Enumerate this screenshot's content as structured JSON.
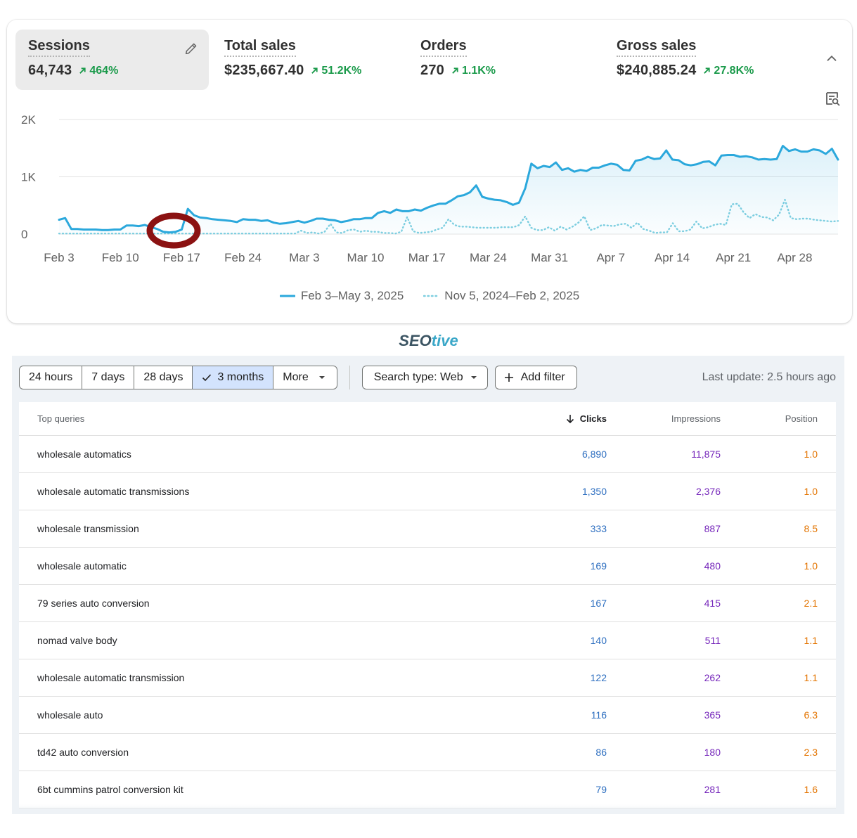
{
  "metrics": [
    {
      "label": "Sessions",
      "value": "64,743",
      "delta": "464%",
      "active": true
    },
    {
      "label": "Total sales",
      "value": "$235,667.40",
      "delta": "51.2K%"
    },
    {
      "label": "Orders",
      "value": "270",
      "delta": "1.1K%"
    },
    {
      "label": "Gross sales",
      "value": "$240,885.24",
      "delta": "27.8K%"
    }
  ],
  "icons": {
    "edit": "pencil-icon",
    "collapse": "chevron-up-icon",
    "zoom": "chart-search-icon",
    "delta": "arrow-up-right-icon",
    "sort": "arrow-down-icon",
    "check": "check-icon",
    "dropdown": "caret-down-icon",
    "add": "plus-icon"
  },
  "chart_data": {
    "type": "line",
    "x_tick_labels": [
      "Feb 3",
      "Feb 10",
      "Feb 17",
      "Feb 24",
      "Mar 3",
      "Mar 10",
      "Mar 17",
      "Mar 24",
      "Mar 31",
      "Apr 7",
      "Apr 14",
      "Apr 21",
      "Apr 28"
    ],
    "y_tick_labels": [
      "2K",
      "1K",
      "0"
    ],
    "ylim": [
      0,
      2000
    ],
    "x_range": [
      "Feb 3",
      "May 3"
    ],
    "grid": true,
    "legend_position": "bottom-center",
    "annotation": "red circle around Feb 14-Feb 17 dip",
    "series": [
      {
        "name": "Feb 3–May 3, 2025",
        "style": "solid",
        "color": "#2ba8dc",
        "values": [
          250,
          280,
          90,
          90,
          80,
          80,
          80,
          70,
          70,
          80,
          80,
          150,
          150,
          140,
          160,
          120,
          90,
          40,
          30,
          40,
          80,
          440,
          330,
          290,
          280,
          260,
          250,
          240,
          230,
          210,
          260,
          250,
          250,
          230,
          240,
          200,
          180,
          190,
          210,
          230,
          200,
          230,
          270,
          270,
          250,
          240,
          210,
          230,
          260,
          260,
          280,
          280,
          370,
          400,
          370,
          430,
          400,
          400,
          430,
          410,
          460,
          500,
          530,
          530,
          590,
          660,
          680,
          730,
          850,
          650,
          620,
          600,
          590,
          560,
          510,
          550,
          800,
          1230,
          1150,
          1190,
          1170,
          1250,
          1120,
          1150,
          1090,
          1120,
          1100,
          1160,
          1160,
          1200,
          1230,
          1210,
          1120,
          1110,
          1280,
          1300,
          1350,
          1310,
          1320,
          1460,
          1300,
          1290,
          1220,
          1200,
          1220,
          1260,
          1270,
          1200,
          1370,
          1380,
          1380,
          1350,
          1360,
          1340,
          1300,
          1310,
          1300,
          1310,
          1540,
          1450,
          1480,
          1440,
          1440,
          1480,
          1460,
          1400,
          1490,
          1300
        ]
      },
      {
        "name": "Nov 5, 2024–Feb 2, 2025",
        "style": "dotted",
        "color": "#7fcfe0",
        "values": [
          10,
          10,
          10,
          10,
          10,
          10,
          10,
          10,
          10,
          10,
          10,
          10,
          10,
          10,
          10,
          10,
          10,
          10,
          10,
          10,
          10,
          10,
          10,
          10,
          10,
          10,
          10,
          10,
          10,
          10,
          10,
          10,
          10,
          10,
          10,
          10,
          10,
          10,
          10,
          10,
          10,
          60,
          20,
          30,
          10,
          40,
          180,
          30,
          20,
          70,
          80,
          40,
          60,
          40,
          40,
          20,
          20,
          10,
          40,
          300,
          50,
          20,
          30,
          40,
          80,
          110,
          260,
          160,
          130,
          130,
          120,
          110,
          110,
          110,
          110,
          120,
          120,
          120,
          160,
          310,
          110,
          70,
          70,
          120,
          60,
          130,
          80,
          130,
          200,
          310,
          70,
          100,
          160,
          150,
          140,
          170,
          180,
          110,
          200,
          90,
          60,
          20,
          30,
          30,
          190,
          50,
          50,
          80,
          220,
          100,
          120,
          160,
          180,
          160,
          520,
          530,
          380,
          280,
          350,
          300,
          290,
          240,
          340,
          600,
          280,
          260,
          270,
          270,
          250,
          240,
          230,
          220,
          230
        ]
      }
    ]
  },
  "brand": {
    "part1": "SEO",
    "part2": "tive"
  },
  "toolbar": {
    "ranges": [
      {
        "label": "24 hours",
        "selected": false
      },
      {
        "label": "7 days",
        "selected": false
      },
      {
        "label": "28 days",
        "selected": false
      },
      {
        "label": "3 months",
        "selected": true
      },
      {
        "label": "More",
        "selected": false
      }
    ],
    "search_type": "Search type: Web",
    "add_filter": "Add filter",
    "last_update": "Last update: 2.5 hours ago"
  },
  "table": {
    "headers": {
      "query": "Top queries",
      "clicks": "Clicks",
      "impressions": "Impressions",
      "position": "Position"
    },
    "rows": [
      {
        "query": "wholesale automatics",
        "clicks": "6,890",
        "impressions": "11,875",
        "position": "1.0"
      },
      {
        "query": "wholesale automatic transmissions",
        "clicks": "1,350",
        "impressions": "2,376",
        "position": "1.0"
      },
      {
        "query": "wholesale transmission",
        "clicks": "333",
        "impressions": "887",
        "position": "8.5"
      },
      {
        "query": "wholesale automatic",
        "clicks": "169",
        "impressions": "480",
        "position": "1.0"
      },
      {
        "query": "79 series auto conversion",
        "clicks": "167",
        "impressions": "415",
        "position": "2.1"
      },
      {
        "query": "nomad valve body",
        "clicks": "140",
        "impressions": "511",
        "position": "1.1"
      },
      {
        "query": "wholesale automatic transmission",
        "clicks": "122",
        "impressions": "262",
        "position": "1.1"
      },
      {
        "query": "wholesale auto",
        "clicks": "116",
        "impressions": "365",
        "position": "6.3"
      },
      {
        "query": "td42 auto conversion",
        "clicks": "86",
        "impressions": "180",
        "position": "2.3"
      },
      {
        "query": "6bt cummins patrol conversion kit",
        "clicks": "79",
        "impressions": "281",
        "position": "1.6"
      }
    ]
  }
}
